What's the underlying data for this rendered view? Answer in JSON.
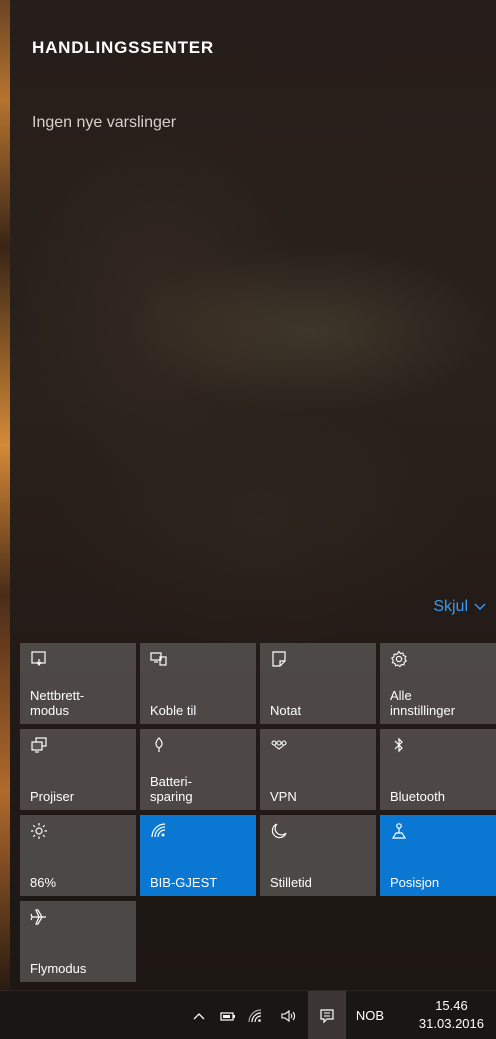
{
  "action_center": {
    "title": "HANDLINGSSENTER",
    "no_notifications": "Ingen nye varslinger",
    "collapse_label": "Skjul"
  },
  "tiles": [
    {
      "label": "Nettbrett-\nmodus",
      "icon": "tablet-mode-icon",
      "active": false
    },
    {
      "label": "Koble til",
      "icon": "connect-icon",
      "active": false
    },
    {
      "label": "Notat",
      "icon": "note-icon",
      "active": false
    },
    {
      "label": "Alle\ninnstillinger",
      "icon": "gear-icon",
      "active": false
    },
    {
      "label": "Projiser",
      "icon": "project-icon",
      "active": false
    },
    {
      "label": "Batteri-\nsparing",
      "icon": "battery-saver-icon",
      "active": false
    },
    {
      "label": "VPN",
      "icon": "vpn-icon",
      "active": false
    },
    {
      "label": "Bluetooth",
      "icon": "bluetooth-icon",
      "active": false
    },
    {
      "label": "86%",
      "icon": "brightness-icon",
      "active": false
    },
    {
      "label": "BIB-GJEST",
      "icon": "wifi-icon",
      "active": true
    },
    {
      "label": "Stilletid",
      "icon": "moon-icon",
      "active": false
    },
    {
      "label": "Posisjon",
      "icon": "location-icon",
      "active": true
    },
    {
      "label": "Flymodus",
      "icon": "airplane-icon",
      "active": false
    }
  ],
  "taskbar": {
    "language": "NOB",
    "time": "15.46",
    "date": "31.03.2016"
  },
  "colors": {
    "accent": "#0a78d2",
    "link": "#3a9af0",
    "tile": "#5a5654"
  }
}
